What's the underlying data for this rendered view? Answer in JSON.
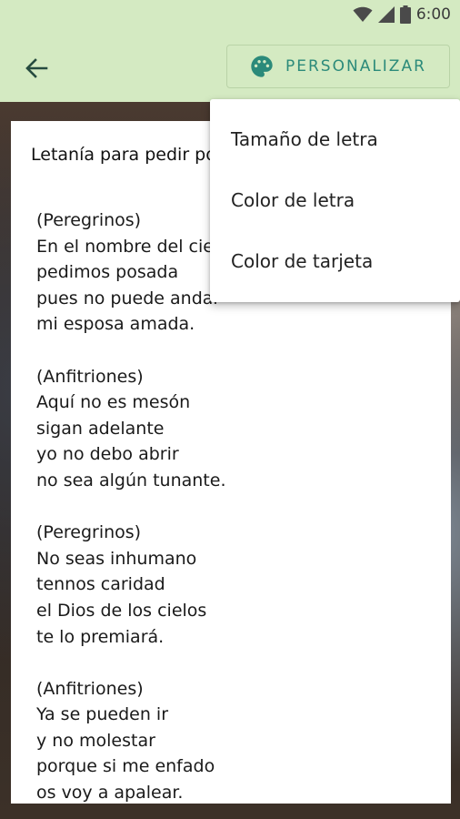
{
  "status_bar": {
    "time": "6:00",
    "icons": [
      "wifi-icon",
      "signal-icon",
      "battery-icon"
    ]
  },
  "app_bar": {
    "back_icon": "arrow-back-icon",
    "personalize_button": {
      "icon": "palette-icon",
      "label": "PERSONALIZAR"
    }
  },
  "card": {
    "title": "Letanía para pedir posada",
    "stanzas": [
      [
        "(Peregrinos)",
        "En el nombre del cielo",
        "pedimos posada",
        "pues no puede andar",
        "mi esposa amada."
      ],
      [
        "(Anfitriones)",
        "Aquí no es mesón",
        "sigan adelante",
        "yo no debo abrir",
        "no sea algún tunante."
      ],
      [
        "(Peregrinos)",
        "No seas inhumano",
        "tennos caridad",
        "el Dios de los cielos",
        "te lo premiará."
      ],
      [
        "(Anfitriones)",
        "Ya se pueden ir",
        "y no molestar",
        "porque si me enfado",
        "os voy a apalear."
      ]
    ]
  },
  "menu": {
    "items": [
      "Tamaño de letra",
      "Color de letra",
      "Color de tarjeta"
    ]
  },
  "colors": {
    "app_bar": "#d4eac2",
    "accent": "#2b8a7a",
    "card": "#ffffff"
  }
}
